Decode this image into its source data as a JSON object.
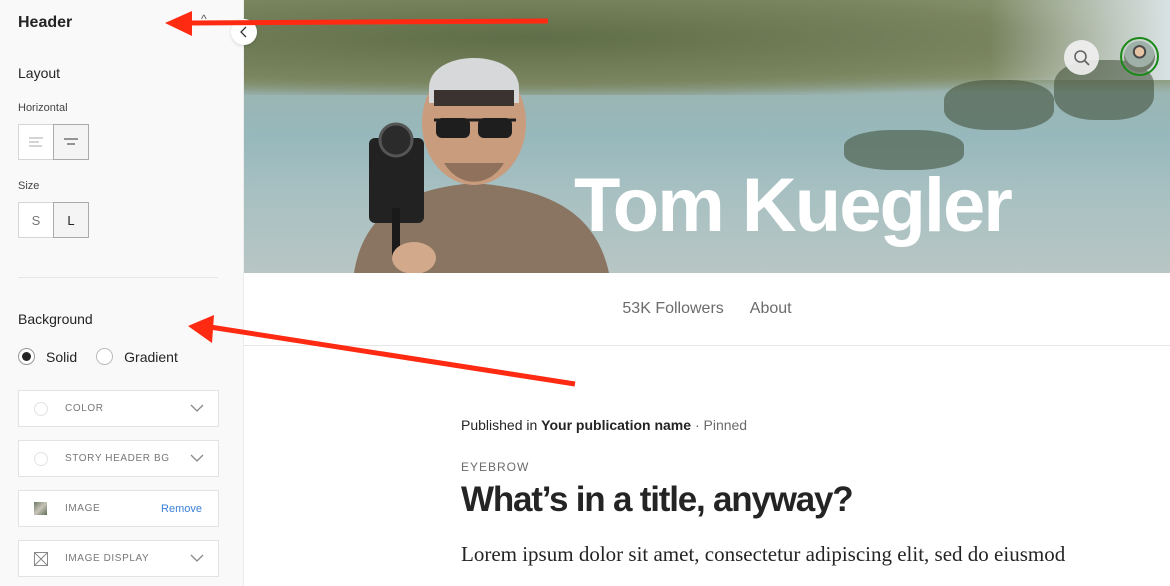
{
  "sidebar": {
    "title": "Header",
    "collapse_caret": "^",
    "layout": {
      "label": "Layout",
      "horizontal_label": "Horizontal",
      "horizontal_options": [
        "align-left",
        "align-center"
      ],
      "horizontal_selected": "align-center",
      "size_label": "Size",
      "size_options": [
        "S",
        "L"
      ],
      "size_selected": "L"
    },
    "background": {
      "label": "Background",
      "type_options": [
        "Solid",
        "Gradient"
      ],
      "type_selected": "Solid",
      "fields": [
        {
          "label": "COLOR",
          "icon": "color-swatch-icon",
          "action": "chevron-down-icon"
        },
        {
          "label": "STORY HEADER BG",
          "icon": "color-swatch-icon",
          "action": "chevron-down-icon"
        },
        {
          "label": "IMAGE",
          "icon": "image-thumbnail-icon",
          "action_label": "Remove"
        },
        {
          "label": "IMAGE DISPLAY",
          "icon": "image-display-icon",
          "action": "chevron-down-icon"
        }
      ]
    }
  },
  "hero": {
    "name": "Tom Kuegler",
    "search_icon": "search-icon",
    "avatar": "profile-avatar"
  },
  "profile_nav": {
    "followers": "53K Followers",
    "about": "About"
  },
  "post": {
    "published_prefix": "Published in",
    "publication": "Your publication name",
    "separator": "·",
    "status": "Pinned",
    "eyebrow": "EYEBROW",
    "title": "What’s in a title, anyway?",
    "excerpt": "Lorem ipsum dolor sit amet, consectetur adipiscing elit, sed do eiusmod"
  },
  "colors": {
    "annotation_arrow": "#ff2a12",
    "link_blue": "#3b82d6",
    "avatar_ring": "#1a8917"
  }
}
